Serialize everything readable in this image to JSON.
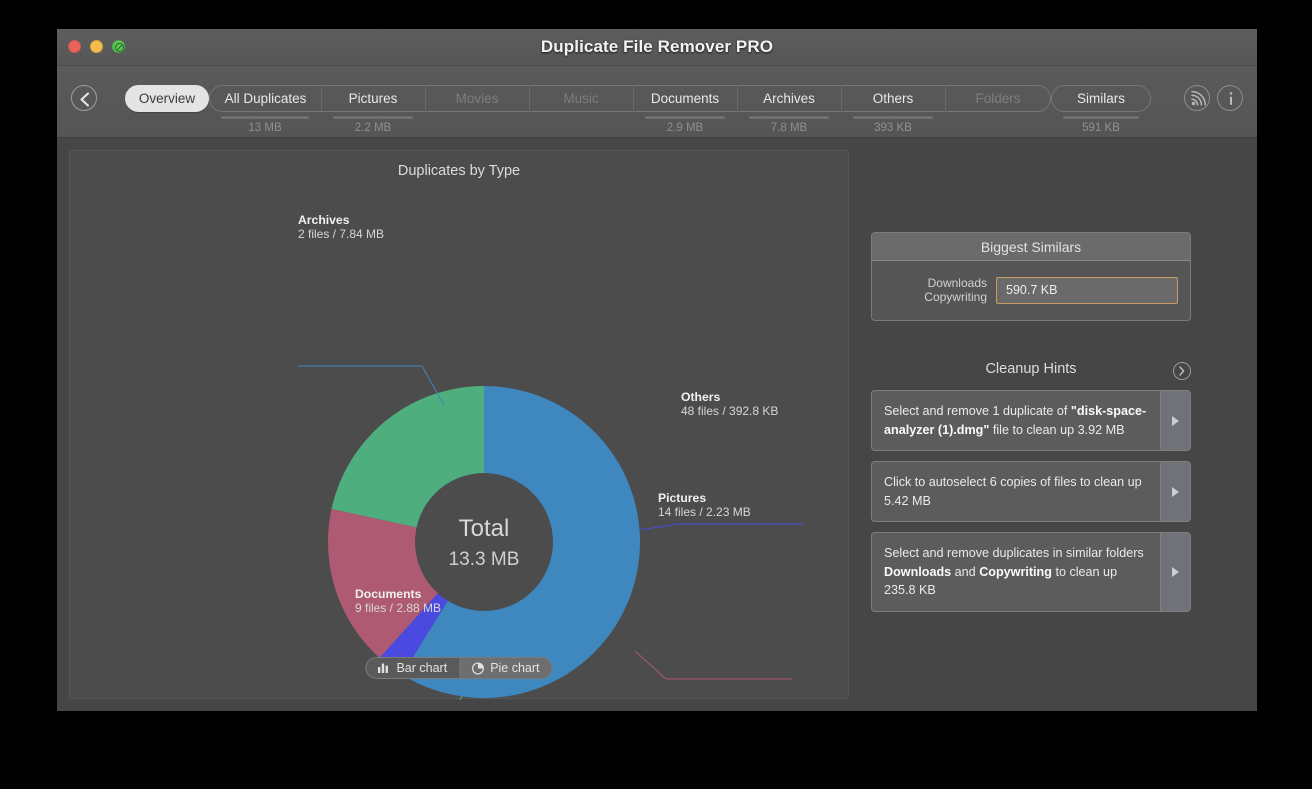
{
  "window": {
    "title": "Duplicate File Remover PRO",
    "traffic_lights": [
      "close-red",
      "minimize-yellow",
      "fullscreen-green"
    ]
  },
  "toolbar": {
    "back_icon": "chevron-left-icon",
    "rss_icon": "rss-icon",
    "info_icon": "info-icon",
    "tabs": [
      {
        "label": "Overview",
        "size": "",
        "active": true,
        "disabled": false
      },
      {
        "label": "All Duplicates",
        "size": "13 MB",
        "active": false,
        "disabled": false
      },
      {
        "label": "Pictures",
        "size": "2.2 MB",
        "active": false,
        "disabled": false
      },
      {
        "label": "Movies",
        "size": "",
        "active": false,
        "disabled": true
      },
      {
        "label": "Music",
        "size": "",
        "active": false,
        "disabled": true
      },
      {
        "label": "Documents",
        "size": "2.9 MB",
        "active": false,
        "disabled": false
      },
      {
        "label": "Archives",
        "size": "7.8 MB",
        "active": false,
        "disabled": false
      },
      {
        "label": "Others",
        "size": "393 KB",
        "active": false,
        "disabled": false
      },
      {
        "label": "Folders",
        "size": "",
        "active": false,
        "disabled": true
      },
      {
        "label": "Similars",
        "size": "591 KB",
        "active": false,
        "disabled": false
      }
    ]
  },
  "chart_panel": {
    "title": "Duplicates by Type",
    "center_label": "Total",
    "center_value": "13.3 MB",
    "toggle": {
      "bar_label": "Bar chart",
      "pie_label": "Pie chart",
      "selected": "Pie chart",
      "bar_icon": "bar-chart-icon",
      "pie_icon": "pie-chart-icon"
    }
  },
  "chart_data": {
    "type": "pie",
    "title": "Duplicates by Type",
    "subtitle": "Total 13.3 MB",
    "categories": [
      "Archives",
      "Others",
      "Pictures",
      "Documents"
    ],
    "values": [
      7.84,
      0.3836,
      2.23,
      2.88
    ],
    "unit": "MB",
    "colors": [
      "#3f87bf",
      "#4a4ae0",
      "#ad5a72",
      "#4fae7e"
    ],
    "labels": [
      {
        "name": "Archives",
        "files": 2,
        "size": "7.84 MB",
        "detail": "2 files / 7.84 MB",
        "color": "#3f87bf"
      },
      {
        "name": "Others",
        "files": 48,
        "size": "392.8 KB",
        "detail": "48 files / 392.8 KB",
        "color": "#4a4ae0"
      },
      {
        "name": "Pictures",
        "files": 14,
        "size": "2.23 MB",
        "detail": "14 files / 2.23 MB",
        "color": "#ad5a72"
      },
      {
        "name": "Documents",
        "files": 9,
        "size": "2.88 MB",
        "detail": "9 files / 2.88 MB",
        "color": "#4fae7e"
      }
    ],
    "legend": "callout-labels",
    "grid": false
  },
  "biggest_similars": {
    "header": "Biggest Similars",
    "row_label_line1": "Downloads",
    "row_label_line2": "Copywriting",
    "row_value": "590.7 KB",
    "bar_border_color": "#c99a63"
  },
  "cleanup_hints": {
    "title": "Cleanup Hints",
    "next_icon": "chevron-right-circle-icon",
    "items": [
      {
        "parts": [
          {
            "t": "Select and remove 1 duplicate of ",
            "b": false
          },
          {
            "t": "\"disk-space-analyzer (1).dmg\"",
            "b": true
          },
          {
            "t": " file to clean up 3.92 MB",
            "b": false
          }
        ]
      },
      {
        "parts": [
          {
            "t": "Click to autoselect 6 copies of files to clean up 5.42 MB",
            "b": false
          }
        ]
      },
      {
        "parts": [
          {
            "t": "Select and remove duplicates in similar folders ",
            "b": false
          },
          {
            "t": "Downloads",
            "b": true
          },
          {
            "t": " and ",
            "b": false
          },
          {
            "t": "Copywriting",
            "b": true
          },
          {
            "t": " to clean up 235.8 KB",
            "b": false
          }
        ]
      }
    ]
  }
}
